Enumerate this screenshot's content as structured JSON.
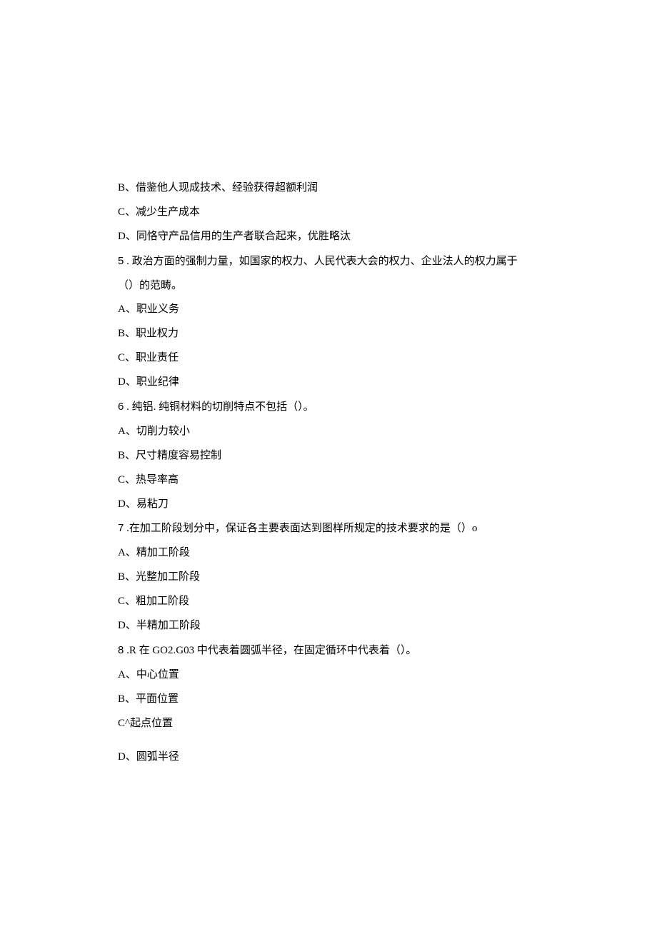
{
  "lines": {
    "l01": "B、借鉴他人现成技术、经验获得超额利润",
    "l02": "C、减少生产成本",
    "l03": "D、同恪守产品信用的生产者联合起来，优胜略汰",
    "l04a": "5",
    "l04b": "   . 政治方面的强制力量，如国家的权力、人民代表大会的权力、企业法人的权力属于",
    "l05": "（）的范畴。",
    "l06": "A、职业义务",
    "l07": "B、职业权力",
    "l08": "C、职业责任",
    "l09": "D、职业纪律",
    "l10a": "6",
    "l10b": "   . 纯铝. 纯铜材料的切削特点不包括（）。",
    "l11": "A、切削力较小",
    "l12": "B、尺寸精度容易控制",
    "l13": "C、热导率高",
    "l14": "D、易粘刀",
    "l15a": "7",
    "l15b": "   .在加工阶段划分中，保证各主要表面达到图样所规定的技术要求的是（）o",
    "l16": "A、精加工阶段",
    "l17": "B、光整加工阶段",
    "l18": "C、粗加工阶段",
    "l19": "D、半精加工阶段",
    "l20a": "8",
    "l20b": "   .R 在 GO2.G03 中代表着圆弧半径，在固定循环中代表着（）。",
    "l21": "A、中心位置",
    "l22": "B、平面位置",
    "l23": "C^起点位置",
    "l24": "D、圆弧半径"
  }
}
